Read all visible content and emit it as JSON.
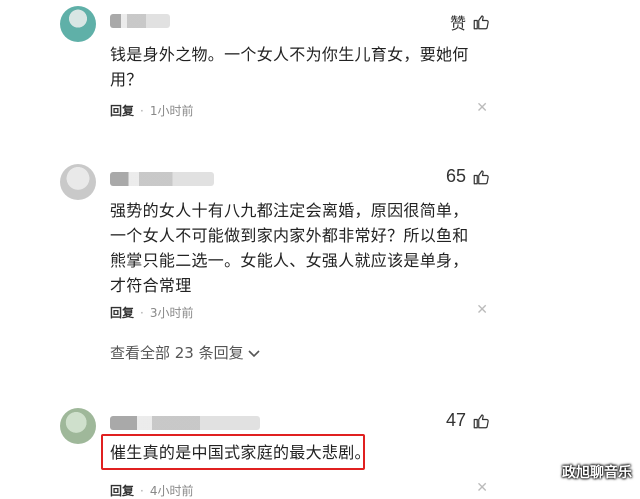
{
  "comments": [
    {
      "likes_label": "赞",
      "text": "钱是身外之物。一个女人不为你生儿育女，要她何用？",
      "reply_label": "回复",
      "time": "1小时前"
    },
    {
      "likes_label": "65",
      "text": "强势的女人十有八九都注定会离婚，原因很简单，一个女人不可能做到家内家外都非常好？所以鱼和熊掌只能二选一。女能人、女强人就应该是单身，才符合常理",
      "reply_label": "回复",
      "time": "3小时前",
      "view_all": "查看全部 23 条回复"
    },
    {
      "likes_label": "47",
      "text": "催生真的是中国式家庭的最大悲剧。",
      "reply_label": "回复",
      "time": "4小时前"
    }
  ],
  "icons": {
    "like": "thumbs-up-icon",
    "close": "close-icon",
    "expand": "chevron-down-icon"
  },
  "colors": {
    "highlight": "#e02020",
    "meta": "#888888"
  },
  "watermark": "政旭聊音乐"
}
